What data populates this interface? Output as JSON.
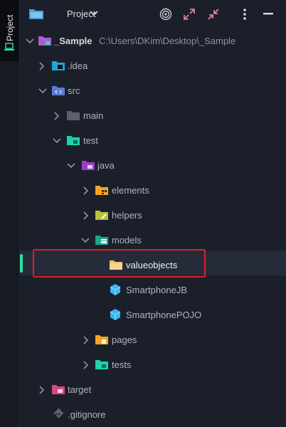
{
  "sidebar": {
    "tab_label": "Project"
  },
  "toolbar": {
    "view_label": "Project"
  },
  "tree": {
    "root_name": "_Sample",
    "root_path": "C:\\Users\\DKim\\Desktop\\_Sample",
    "idea": ".idea",
    "src": "src",
    "main": "main",
    "test": "test",
    "java": "java",
    "elements": "elements",
    "helpers": "helpers",
    "models": "models",
    "valueobjects": "valueobjects",
    "smartphone_jb": "SmartphoneJB",
    "smartphone_pojo": "SmartphonePOJO",
    "pages": "pages",
    "tests": "tests",
    "target": "target",
    "gitignore": ".gitignore"
  },
  "colors": {
    "accent_green": "#2fe0a8",
    "highlight_red": "#e01e24",
    "folder_yellow": "#f5a623",
    "folder_teal": "#1fd1b0",
    "folder_blue": "#5b7bd6",
    "folder_purple": "#b05ad6",
    "folder_pink": "#e0457a",
    "class_blue": "#3ab7f0"
  }
}
